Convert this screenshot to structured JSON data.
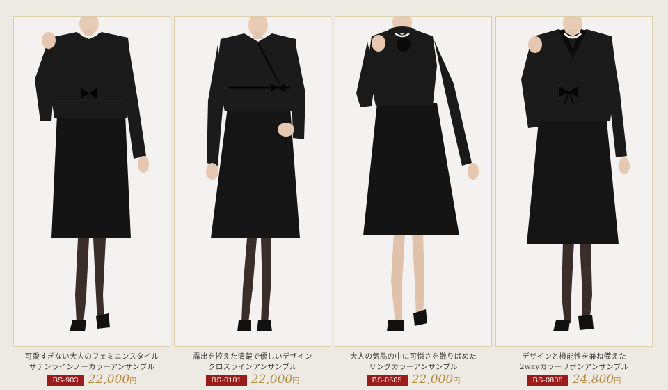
{
  "products": [
    {
      "line1": "可愛すぎない大人のフェミニンスタイル",
      "line2": "サテンラインノーカラーアンサンブル",
      "code": "BS-903",
      "price": "22,000",
      "yen": "円"
    },
    {
      "line1": "露出を控えた清楚で優しいデザイン",
      "line2": "クロスラインアンサンブル",
      "code": "BS-0101",
      "price": "22,000",
      "yen": "円"
    },
    {
      "line1": "大人の気品の中に可憐さを散りばめた",
      "line2": "リングカラーアンサンブル",
      "code": "BS-0505",
      "price": "22,000",
      "yen": "円"
    },
    {
      "line1": "デザインと機能性を兼ね備えた",
      "line2": "2wayカラーリボンアンサンブル",
      "code": "BS-0808",
      "price": "24,800",
      "yen": "円"
    }
  ],
  "colors": {
    "background": "#ede9e3",
    "code_badge": "#9b1b1b",
    "price": "#b98a3a",
    "garment": "#111111"
  }
}
